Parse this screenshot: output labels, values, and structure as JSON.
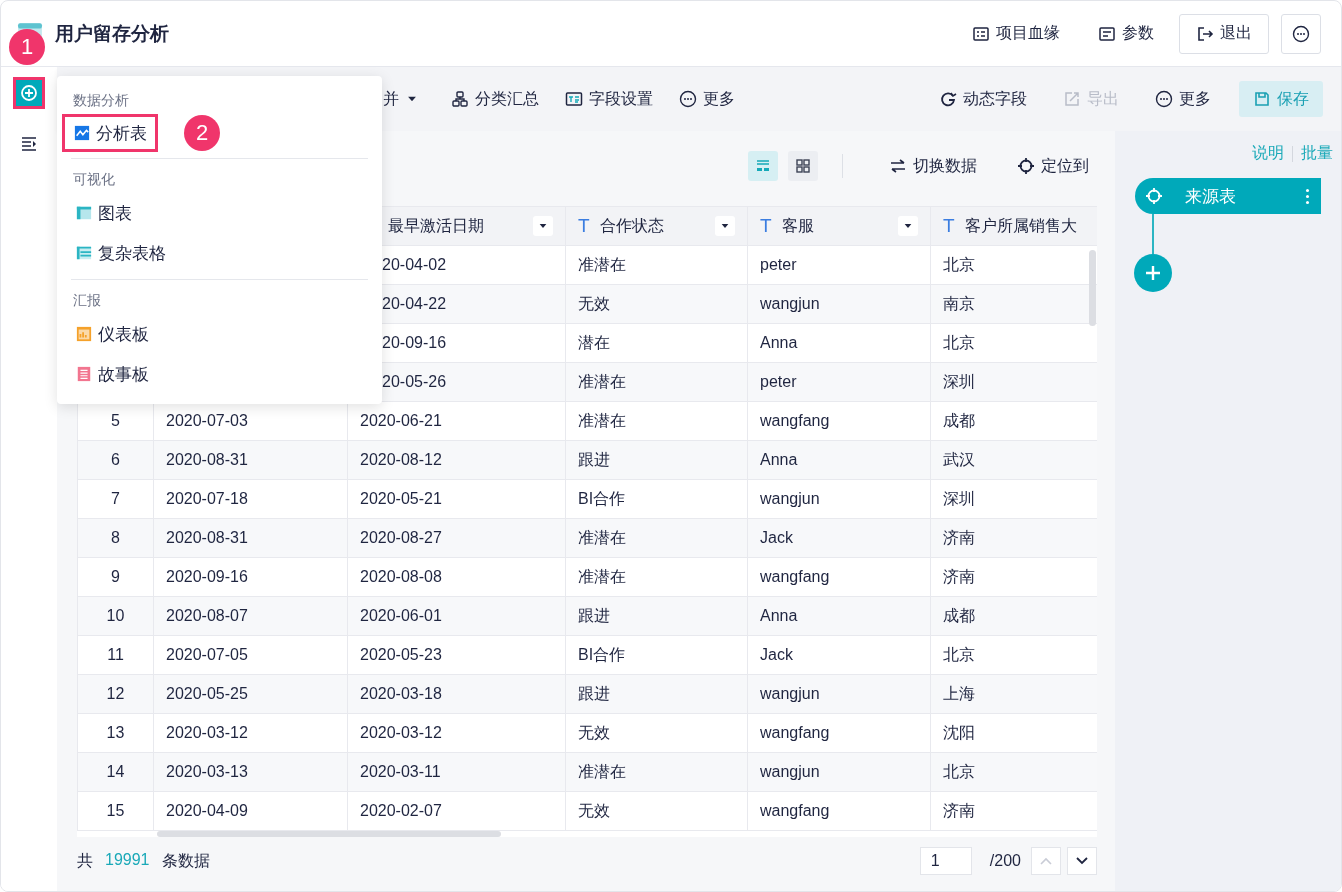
{
  "header": {
    "title": "用户留存分析",
    "actions": [
      {
        "label": "项目血缘",
        "kind": "lineage"
      },
      {
        "label": "参数",
        "kind": "params"
      },
      {
        "label": "退出",
        "kind": "exit"
      },
      {
        "kind": "more"
      }
    ]
  },
  "rail": {
    "add_button": {
      "annotated": true,
      "callout": "1"
    }
  },
  "toolbar": {
    "left": [
      {
        "label": "并",
        "kind": "dropdown"
      },
      {
        "label": "分类汇总",
        "kind": "group"
      },
      {
        "label": "字段设置",
        "kind": "fields"
      },
      {
        "label": "更多",
        "kind": "more"
      }
    ],
    "right": [
      {
        "label": "动态字段",
        "kind": "dynamic",
        "disabled": false
      },
      {
        "label": "导出",
        "kind": "export",
        "disabled": true
      },
      {
        "label": "更多",
        "kind": "more",
        "disabled": false
      },
      {
        "label": "保存",
        "kind": "save",
        "disabled": false
      }
    ]
  },
  "menu": {
    "sections": [
      {
        "title": "数据分析",
        "items": [
          {
            "label": "分析表",
            "kind": "analysis",
            "annotated": true,
            "callout": "2"
          }
        ]
      },
      {
        "title": "可视化",
        "items": [
          {
            "label": "图表",
            "kind": "chart",
            "annotated": false
          },
          {
            "label": "复杂表格",
            "kind": "complex",
            "annotated": false
          }
        ]
      },
      {
        "title": "汇报",
        "items": [
          {
            "label": "仪表板",
            "kind": "dashboard",
            "annotated": false
          },
          {
            "label": "故事板",
            "kind": "story",
            "annotated": false
          }
        ]
      }
    ]
  },
  "table_tools": {
    "views": [
      {
        "kind": "list",
        "selected": true
      },
      {
        "kind": "grid",
        "selected": false
      }
    ],
    "actions": [
      {
        "label": "切换数据",
        "kind": "switch"
      },
      {
        "label": "定位到",
        "kind": "locate"
      }
    ]
  },
  "table": {
    "columns": [
      {
        "label": "最早激活日期",
        "sort_button": true
      },
      {
        "label": "合作状态",
        "type_mark": "T",
        "sort_button": true
      },
      {
        "label": "客服",
        "type_mark": "T",
        "sort_button": true
      },
      {
        "label": "客户所属销售大",
        "type_mark": "T",
        "sort_button": false
      }
    ],
    "rows": [
      {
        "cells": [
          "20-04-02",
          "准潜在",
          "peter",
          "北京"
        ]
      },
      {
        "cells": [
          "20-04-22",
          "无效",
          "wangjun",
          "南京"
        ]
      },
      {
        "cells": [
          "20-09-16",
          "潜在",
          "Anna",
          "北京"
        ]
      },
      {
        "cells": [
          "20-05-26",
          "准潜在",
          "peter",
          "深圳"
        ]
      },
      {
        "cells": [
          "5",
          "2020-07-03",
          "2020-06-21",
          "准潜在",
          "wangfang",
          "成都"
        ]
      },
      {
        "cells": [
          "6",
          "2020-08-31",
          "2020-08-12",
          "跟进",
          "Anna",
          "武汉"
        ]
      },
      {
        "cells": [
          "7",
          "2020-07-18",
          "2020-05-21",
          "BI合作",
          "wangjun",
          "深圳"
        ]
      },
      {
        "cells": [
          "8",
          "2020-08-31",
          "2020-08-27",
          "准潜在",
          "Jack",
          "济南"
        ]
      },
      {
        "cells": [
          "9",
          "2020-09-16",
          "2020-08-08",
          "准潜在",
          "wangfang",
          "济南"
        ]
      },
      {
        "cells": [
          "10",
          "2020-08-07",
          "2020-06-01",
          "跟进",
          "Anna",
          "成都"
        ]
      },
      {
        "cells": [
          "11",
          "2020-07-05",
          "2020-05-23",
          "BI合作",
          "Jack",
          "北京"
        ]
      },
      {
        "cells": [
          "12",
          "2020-05-25",
          "2020-03-18",
          "跟进",
          "wangjun",
          "上海"
        ]
      },
      {
        "cells": [
          "13",
          "2020-03-12",
          "2020-03-12",
          "无效",
          "wangfang",
          "沈阳"
        ]
      },
      {
        "cells": [
          "14",
          "2020-03-13",
          "2020-03-11",
          "准潜在",
          "wangjun",
          "北京"
        ]
      },
      {
        "cells": [
          "15",
          "2020-04-09",
          "2020-02-07",
          "无效",
          "wangfang",
          "济南"
        ]
      }
    ]
  },
  "footer": {
    "prefix": "共",
    "count": "19991",
    "suffix": "条数据",
    "page": "1",
    "total": "/200",
    "prev_disabled": true,
    "next_disabled": false
  },
  "flow": {
    "links": [
      "说明",
      "批量"
    ],
    "node": {
      "label": "来源表"
    }
  }
}
